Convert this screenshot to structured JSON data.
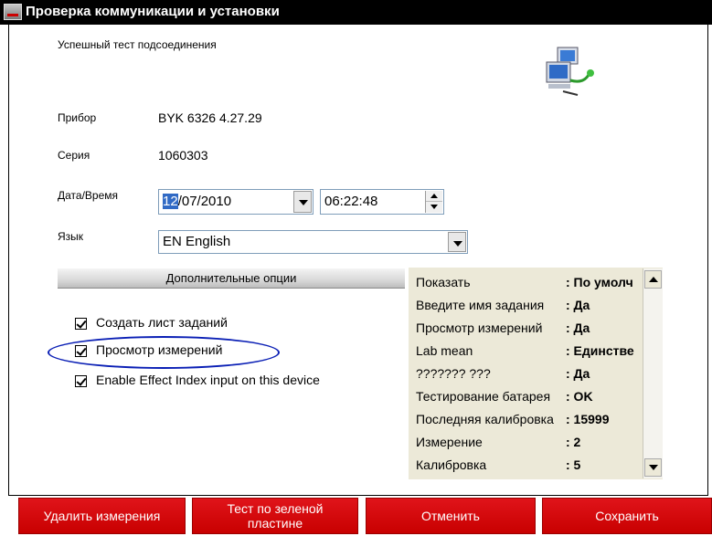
{
  "window": {
    "title": "Проверка коммуникации и установки"
  },
  "status": {
    "text": "Успешный тест подсоединения"
  },
  "device": {
    "label": "Прибор",
    "value": "BYK 6326 4.27.29"
  },
  "series": {
    "label": "Серия",
    "value": "1060303"
  },
  "datetime": {
    "label": "Дата/Время",
    "date_selected": "12",
    "date_rest": "/07/2010",
    "time": "06:22:48"
  },
  "language": {
    "label": "Язык",
    "value": "EN English"
  },
  "options": {
    "header": "Дополнительные опции",
    "checkboxes": [
      {
        "label": "Создать лист заданий",
        "checked": true
      },
      {
        "label": "Просмотр измерений",
        "checked": true
      },
      {
        "label": "Enable Effect Index input on this device",
        "checked": true
      }
    ]
  },
  "settings": {
    "rows": [
      {
        "name": "Показать",
        "value": ": По умолч"
      },
      {
        "name": "Введите имя задания",
        "value": ": Да"
      },
      {
        "name": "Просмотр измерений",
        "value": ": Да"
      },
      {
        "name": "Lab mean",
        "value": ": Единстве"
      },
      {
        "name": "??????? ???",
        "value": ": Да"
      },
      {
        "name": "Тестирование батарея",
        "value": ": OK"
      },
      {
        "name": "Последняя калибровка",
        "value": ": 15999"
      },
      {
        "name": "Измерение",
        "value": ": 2"
      },
      {
        "name": "Калибровка",
        "value": ": 5"
      }
    ]
  },
  "buttons": {
    "delete": "Удалить измерения",
    "green_plate": "Тест по зеленой пластине",
    "cancel": "Отменить",
    "save": "Сохранить"
  },
  "colors": {
    "button_red": "#d40a10",
    "highlight": "#316ac5",
    "annotation": "#0a1fb5"
  }
}
